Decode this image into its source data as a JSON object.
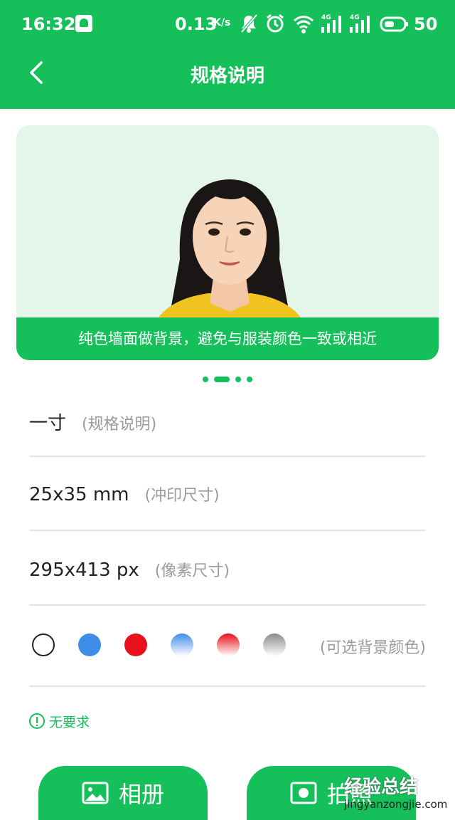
{
  "status_bar": {
    "time": "16:32",
    "speed": "0.13",
    "speed_unit": "K/s",
    "battery": "50",
    "icons": [
      "app-notification-icon",
      "mute-icon",
      "alarm-icon",
      "wifi-icon",
      "signal-4g-icon",
      "signal-4g-icon",
      "battery-icon"
    ]
  },
  "nav": {
    "title": "规格说明",
    "back_icon": "chevron-left-icon"
  },
  "example": {
    "caption": "纯色墙面做背景，避免与服装颜色一致或相近",
    "pager_count": 4,
    "pager_active": 1
  },
  "specs": [
    {
      "value": "一寸",
      "label": "(规格说明)"
    },
    {
      "value": "25x35 mm",
      "label": "(冲印尺寸)"
    },
    {
      "value": "295x413 px",
      "label": "(像素尺寸)"
    }
  ],
  "colors": {
    "label": "(可选背景颜色)",
    "swatches": [
      {
        "name": "white",
        "fill": "#ffffff",
        "gradient": false
      },
      {
        "name": "blue",
        "fill": "#3e8ee8",
        "gradient": false
      },
      {
        "name": "red",
        "fill": "#e8101a",
        "gradient": false
      },
      {
        "name": "blue-gradient",
        "fill": "#3e8ee8",
        "gradient": true
      },
      {
        "name": "red-gradient",
        "fill": "#e8101a",
        "gradient": true
      },
      {
        "name": "gray-gradient",
        "fill": "#8c8c8c",
        "gradient": true
      }
    ]
  },
  "requirement": {
    "text": "无要求"
  },
  "actions": {
    "album_label": "相册",
    "camera_label": "拍照"
  },
  "watermark": {
    "line1": "经验总结",
    "line2": "jingyanzongjie.com"
  },
  "theme": {
    "accent": "#15c05a"
  }
}
